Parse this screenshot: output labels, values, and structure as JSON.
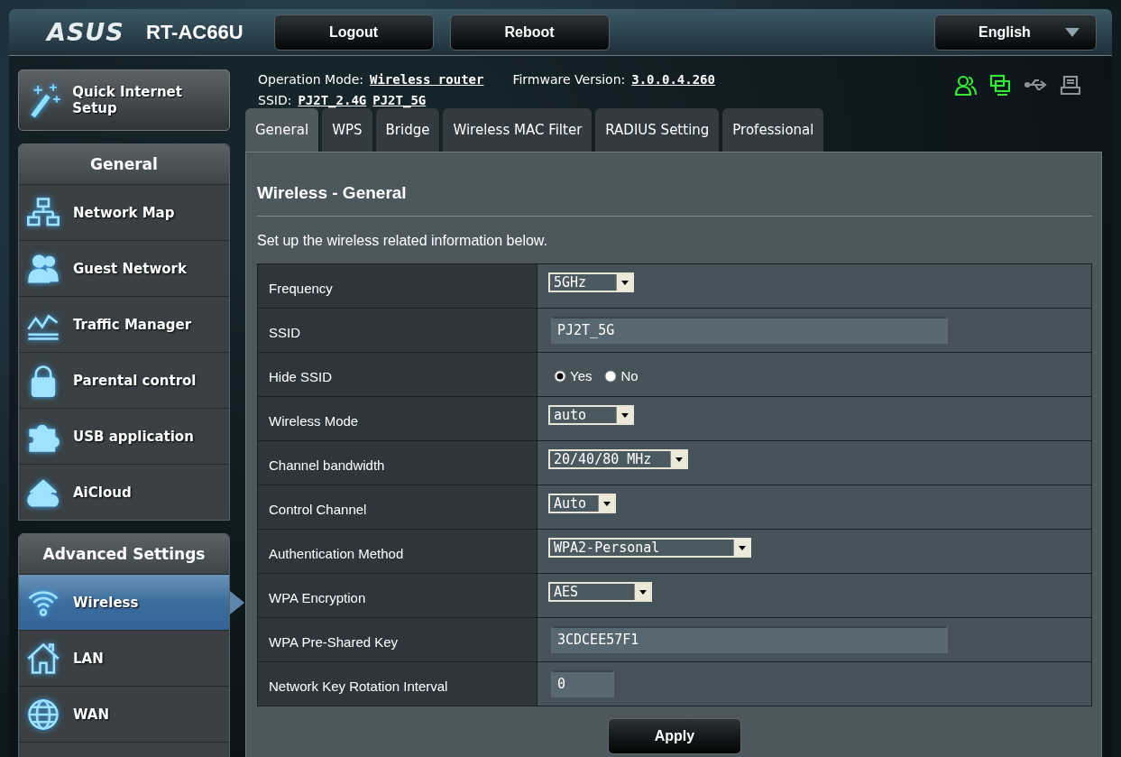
{
  "header": {
    "logo": "ASUS",
    "model": "RT-AC66U",
    "buttons": [
      "Logout",
      "Reboot"
    ],
    "language": "English"
  },
  "info": {
    "mode_label": "Operation Mode:",
    "mode": "Wireless router",
    "firmware_label": "Firmware Version:",
    "firmware": "3.0.0.4.260",
    "ssid_label": "SSID:",
    "ssids": [
      "PJ2T_2.4G",
      "PJ2T_5G"
    ]
  },
  "status_icons": [
    {
      "kind": "clients",
      "on": true
    },
    {
      "kind": "devices",
      "on": true
    },
    {
      "kind": "usb",
      "on": false
    },
    {
      "kind": "printer",
      "on": false
    }
  ],
  "quick_setup": "Quick Internet Setup",
  "sidebar": [
    {
      "title": "General",
      "items": [
        {
          "label": "Network Map",
          "kind": "network",
          "selected": false
        },
        {
          "label": "Guest Network",
          "kind": "guests",
          "selected": false
        },
        {
          "label": "Traffic Manager",
          "kind": "traffic",
          "selected": false
        },
        {
          "label": "Parental control",
          "kind": "lock",
          "selected": false
        },
        {
          "label": "USB application",
          "kind": "puzzle",
          "selected": false
        },
        {
          "label": "AiCloud",
          "kind": "cloud",
          "selected": false
        }
      ]
    },
    {
      "title": "Advanced Settings",
      "items": [
        {
          "label": "Wireless",
          "kind": "wifi",
          "selected": true
        },
        {
          "label": "LAN",
          "kind": "house",
          "selected": false
        },
        {
          "label": "WAN",
          "kind": "globe",
          "selected": false
        }
      ]
    }
  ],
  "tabs": [
    {
      "label": "General",
      "selected": true
    },
    {
      "label": "WPS",
      "selected": false
    },
    {
      "label": "Bridge",
      "selected": false
    },
    {
      "label": "Wireless MAC Filter",
      "selected": false
    },
    {
      "label": "RADIUS Setting",
      "selected": false
    },
    {
      "label": "Professional",
      "selected": false
    }
  ],
  "panel": {
    "title": "Wireless - General",
    "description": "Set up the wireless related information below.",
    "rows": [
      {
        "label": "Frequency",
        "kind": "select",
        "value": "5GHz"
      },
      {
        "label": "SSID",
        "kind": "text",
        "value": "PJ2T_5G"
      },
      {
        "label": "Hide SSID",
        "kind": "radio",
        "options": [
          {
            "label": "Yes",
            "selected": true
          },
          {
            "label": "No",
            "selected": false
          }
        ]
      },
      {
        "label": "Wireless Mode",
        "kind": "select",
        "value": "auto"
      },
      {
        "label": "Channel bandwidth",
        "kind": "select",
        "value": "20/40/80 MHz"
      },
      {
        "label": "Control Channel",
        "kind": "select",
        "value": "Auto"
      },
      {
        "label": "Authentication Method",
        "kind": "select",
        "value": "WPA2-Personal"
      },
      {
        "label": "WPA Encryption",
        "kind": "select",
        "value": "AES"
      },
      {
        "label": "WPA Pre-Shared Key",
        "kind": "text",
        "value": "3CDCEE57F1"
      },
      {
        "label": "Network Key Rotation Interval",
        "kind": "text",
        "value": "0"
      }
    ],
    "apply": "Apply"
  }
}
